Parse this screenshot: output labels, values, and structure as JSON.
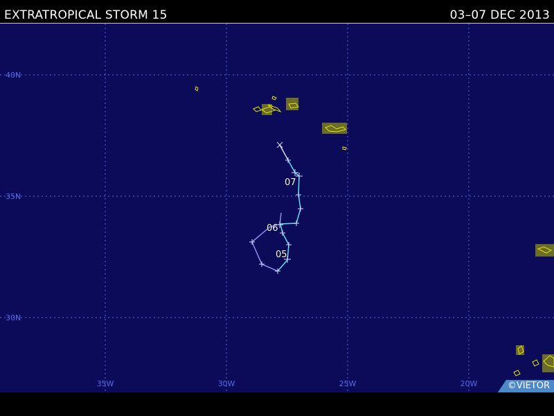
{
  "header": {
    "title": "EXTRATROPICAL STORM 15",
    "dates": "03–07 DEC 2013"
  },
  "map": {
    "lat_labels": [
      "40N",
      "35N",
      "30N"
    ],
    "lon_labels": [
      "35W",
      "30W",
      "25W",
      "20W"
    ],
    "track_labels": [
      "07",
      "06",
      "05"
    ],
    "colors": {
      "ocean": "#0b0b5a",
      "grid": "#5a6ae6",
      "land": "#6b6b2a",
      "coast": "#e6e600",
      "track_cyan": "#5fe0f0",
      "track_purple": "#8a8ef0",
      "track_white": "#d8d8e8"
    }
  },
  "credit": "©VIETOR"
}
